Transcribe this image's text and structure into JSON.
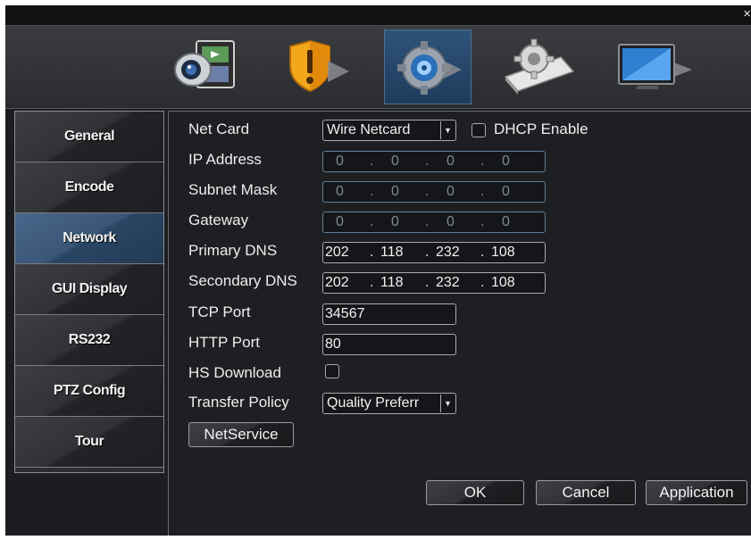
{
  "window": {
    "close_glyph": "×"
  },
  "toolbar": {
    "icons": [
      {
        "name": "record-icon"
      },
      {
        "name": "alarm-icon"
      },
      {
        "name": "system-icon"
      },
      {
        "name": "advanced-icon"
      },
      {
        "name": "info-icon"
      }
    ],
    "active_index": 2
  },
  "sidebar": {
    "items": [
      {
        "label": "General"
      },
      {
        "label": "Encode"
      },
      {
        "label": "Network"
      },
      {
        "label": "GUI Display"
      },
      {
        "label": "RS232"
      },
      {
        "label": "PTZ Config"
      },
      {
        "label": "Tour"
      }
    ],
    "active_index": 2
  },
  "form": {
    "net_card": {
      "label": "Net Card",
      "value": "Wire Netcard"
    },
    "dhcp": {
      "label": "DHCP Enable",
      "checked": false
    },
    "ip_address": {
      "label": "IP Address",
      "octets": [
        "0",
        "0",
        "0",
        "0"
      ]
    },
    "subnet_mask": {
      "label": "Subnet Mask",
      "octets": [
        "0",
        "0",
        "0",
        "0"
      ]
    },
    "gateway": {
      "label": "Gateway",
      "octets": [
        "0",
        "0",
        "0",
        "0"
      ]
    },
    "primary_dns": {
      "label": "Primary DNS",
      "octets": [
        "202",
        "118",
        "232",
        "108"
      ]
    },
    "secondary_dns": {
      "label": "Secondary DNS",
      "octets": [
        "202",
        "118",
        "232",
        "108"
      ]
    },
    "tcp_port": {
      "label": "TCP Port",
      "value": "34567"
    },
    "http_port": {
      "label": "HTTP Port",
      "value": "80"
    },
    "hs_download": {
      "label": "HS Download",
      "checked": false
    },
    "transfer_policy": {
      "label": "Transfer Policy",
      "value": "Quality Preferr"
    },
    "ip_separator": "."
  },
  "buttons": {
    "netservice": "NetService",
    "ok": "OK",
    "cancel": "Cancel",
    "application": "Application"
  },
  "colors": {
    "accent": "#2e5378",
    "disabled_border": "#5e7f9c",
    "background": "#1c1d20"
  }
}
